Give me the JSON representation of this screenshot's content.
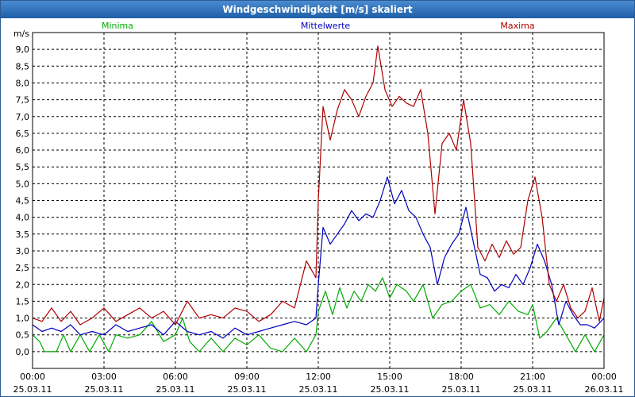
{
  "window": {
    "title": "Windgeschwindigkeit [m/s] skaliert"
  },
  "chart_data": {
    "type": "line",
    "title": "Windgeschwindigkeit [m/s] skaliert",
    "ylabel": "m/s",
    "xlabel": "",
    "ylim": [
      -0.5,
      9.5
    ],
    "xlim": [
      0,
      24
    ],
    "grid": true,
    "legend_placement": "top",
    "y_ticks": [
      "0,0",
      "0,5",
      "1,0",
      "1,5",
      "2,0",
      "2,5",
      "3,0",
      "3,5",
      "4,0",
      "4,5",
      "5,0",
      "5,5",
      "6,0",
      "6,5",
      "7,0",
      "7,5",
      "8,0",
      "8,5",
      "9,0"
    ],
    "x_ticks": [
      {
        "x": 0,
        "time": "00:00",
        "date": "25.03.11"
      },
      {
        "x": 3,
        "time": "03:00",
        "date": "25.03.11"
      },
      {
        "x": 6,
        "time": "06:00",
        "date": "25.03.11"
      },
      {
        "x": 9,
        "time": "09:00",
        "date": "25.03.11"
      },
      {
        "x": 12,
        "time": "12:00",
        "date": "25.03.11"
      },
      {
        "x": 15,
        "time": "15:00",
        "date": "25.03.11"
      },
      {
        "x": 18,
        "time": "18:00",
        "date": "25.03.11"
      },
      {
        "x": 21,
        "time": "21:00",
        "date": "25.03.11"
      },
      {
        "x": 24,
        "time": "00:00",
        "date": "26.03.11"
      }
    ],
    "series": [
      {
        "name": "Minima",
        "color": "#00aa00",
        "points": [
          [
            0,
            0.5
          ],
          [
            0.3,
            0.3
          ],
          [
            0.5,
            0.0
          ],
          [
            1,
            0.0
          ],
          [
            1.3,
            0.5
          ],
          [
            1.6,
            0.0
          ],
          [
            2,
            0.5
          ],
          [
            2.4,
            0.0
          ],
          [
            2.8,
            0.5
          ],
          [
            3.2,
            0.0
          ],
          [
            3.5,
            0.5
          ],
          [
            4,
            0.4
          ],
          [
            4.5,
            0.5
          ],
          [
            5,
            0.9
          ],
          [
            5.5,
            0.3
          ],
          [
            6,
            0.5
          ],
          [
            6.3,
            1.0
          ],
          [
            6.6,
            0.3
          ],
          [
            7,
            0.0
          ],
          [
            7.5,
            0.4
          ],
          [
            8,
            0.0
          ],
          [
            8.5,
            0.4
          ],
          [
            9,
            0.2
          ],
          [
            9.5,
            0.5
          ],
          [
            10,
            0.1
          ],
          [
            10.5,
            0.0
          ],
          [
            11,
            0.4
          ],
          [
            11.5,
            0.0
          ],
          [
            11.9,
            0.5
          ],
          [
            12,
            1.2
          ],
          [
            12.3,
            1.8
          ],
          [
            12.6,
            1.1
          ],
          [
            12.9,
            1.9
          ],
          [
            13.2,
            1.3
          ],
          [
            13.5,
            1.8
          ],
          [
            13.8,
            1.5
          ],
          [
            14.1,
            2.0
          ],
          [
            14.4,
            1.8
          ],
          [
            14.7,
            2.2
          ],
          [
            15,
            1.6
          ],
          [
            15.3,
            2.0
          ],
          [
            15.7,
            1.8
          ],
          [
            16,
            1.5
          ],
          [
            16.4,
            2.0
          ],
          [
            16.8,
            1.0
          ],
          [
            17.2,
            1.4
          ],
          [
            17.6,
            1.5
          ],
          [
            18,
            1.8
          ],
          [
            18.4,
            2.0
          ],
          [
            18.8,
            1.3
          ],
          [
            19.2,
            1.4
          ],
          [
            19.6,
            1.1
          ],
          [
            20,
            1.5
          ],
          [
            20.4,
            1.2
          ],
          [
            20.8,
            1.1
          ],
          [
            21,
            1.4
          ],
          [
            21.3,
            0.4
          ],
          [
            21.6,
            0.6
          ],
          [
            22,
            1.0
          ],
          [
            22.4,
            0.5
          ],
          [
            22.8,
            0.0
          ],
          [
            23.2,
            0.5
          ],
          [
            23.6,
            0.0
          ],
          [
            24,
            0.5
          ]
        ]
      },
      {
        "name": "Mittelwerte",
        "color": "#0000c0",
        "points": [
          [
            0,
            0.8
          ],
          [
            0.4,
            0.6
          ],
          [
            0.8,
            0.7
          ],
          [
            1.2,
            0.6
          ],
          [
            1.6,
            0.8
          ],
          [
            2,
            0.5
          ],
          [
            2.5,
            0.6
          ],
          [
            3,
            0.5
          ],
          [
            3.5,
            0.8
          ],
          [
            4,
            0.6
          ],
          [
            4.5,
            0.7
          ],
          [
            5,
            0.8
          ],
          [
            5.5,
            0.5
          ],
          [
            6,
            0.9
          ],
          [
            6.5,
            0.6
          ],
          [
            7,
            0.5
          ],
          [
            7.5,
            0.6
          ],
          [
            8,
            0.4
          ],
          [
            8.5,
            0.7
          ],
          [
            9,
            0.5
          ],
          [
            9.5,
            0.6
          ],
          [
            10,
            0.7
          ],
          [
            10.5,
            0.8
          ],
          [
            11,
            0.9
          ],
          [
            11.5,
            0.8
          ],
          [
            11.9,
            1.0
          ],
          [
            12,
            2.0
          ],
          [
            12.2,
            3.7
          ],
          [
            12.5,
            3.2
          ],
          [
            12.8,
            3.5
          ],
          [
            13.1,
            3.8
          ],
          [
            13.4,
            4.2
          ],
          [
            13.7,
            3.9
          ],
          [
            14,
            4.1
          ],
          [
            14.3,
            4.0
          ],
          [
            14.6,
            4.5
          ],
          [
            14.9,
            5.2
          ],
          [
            15.2,
            4.4
          ],
          [
            15.5,
            4.8
          ],
          [
            15.8,
            4.2
          ],
          [
            16.1,
            4.0
          ],
          [
            16.4,
            3.5
          ],
          [
            16.7,
            3.1
          ],
          [
            17,
            2.0
          ],
          [
            17.3,
            2.8
          ],
          [
            17.6,
            3.2
          ],
          [
            17.9,
            3.5
          ],
          [
            18.2,
            4.3
          ],
          [
            18.5,
            3.3
          ],
          [
            18.8,
            2.3
          ],
          [
            19.1,
            2.2
          ],
          [
            19.4,
            1.8
          ],
          [
            19.7,
            2.0
          ],
          [
            20,
            1.9
          ],
          [
            20.3,
            2.3
          ],
          [
            20.6,
            2.0
          ],
          [
            20.9,
            2.5
          ],
          [
            21.2,
            3.2
          ],
          [
            21.5,
            2.7
          ],
          [
            21.8,
            2.0
          ],
          [
            22.1,
            0.8
          ],
          [
            22.4,
            1.5
          ],
          [
            22.7,
            1.1
          ],
          [
            23,
            0.8
          ],
          [
            23.3,
            0.8
          ],
          [
            23.6,
            0.7
          ],
          [
            24,
            1.0
          ]
        ]
      },
      {
        "name": "Maxima",
        "color": "#b00000",
        "points": [
          [
            0,
            1.0
          ],
          [
            0.4,
            0.9
          ],
          [
            0.8,
            1.3
          ],
          [
            1.2,
            0.9
          ],
          [
            1.6,
            1.2
          ],
          [
            2,
            0.8
          ],
          [
            2.5,
            1.0
          ],
          [
            3,
            1.3
          ],
          [
            3.5,
            0.9
          ],
          [
            4,
            1.1
          ],
          [
            4.5,
            1.3
          ],
          [
            5,
            1.0
          ],
          [
            5.5,
            1.2
          ],
          [
            6,
            0.8
          ],
          [
            6.5,
            1.5
          ],
          [
            7,
            1.0
          ],
          [
            7.5,
            1.1
          ],
          [
            8,
            1.0
          ],
          [
            8.5,
            1.3
          ],
          [
            9,
            1.2
          ],
          [
            9.5,
            0.9
          ],
          [
            10,
            1.1
          ],
          [
            10.5,
            1.5
          ],
          [
            11,
            1.3
          ],
          [
            11.5,
            2.7
          ],
          [
            11.9,
            2.2
          ],
          [
            12,
            4.5
          ],
          [
            12.2,
            7.3
          ],
          [
            12.5,
            6.3
          ],
          [
            12.8,
            7.2
          ],
          [
            13.1,
            7.8
          ],
          [
            13.4,
            7.5
          ],
          [
            13.7,
            7.0
          ],
          [
            14,
            7.6
          ],
          [
            14.3,
            8.0
          ],
          [
            14.5,
            9.1
          ],
          [
            14.8,
            7.8
          ],
          [
            15.1,
            7.3
          ],
          [
            15.4,
            7.6
          ],
          [
            15.7,
            7.4
          ],
          [
            16,
            7.3
          ],
          [
            16.3,
            7.8
          ],
          [
            16.6,
            6.5
          ],
          [
            16.9,
            4.1
          ],
          [
            17.2,
            6.2
          ],
          [
            17.5,
            6.5
          ],
          [
            17.8,
            6.0
          ],
          [
            18.1,
            7.5
          ],
          [
            18.4,
            6.2
          ],
          [
            18.7,
            3.1
          ],
          [
            19,
            2.7
          ],
          [
            19.3,
            3.2
          ],
          [
            19.6,
            2.8
          ],
          [
            19.9,
            3.3
          ],
          [
            20.2,
            2.9
          ],
          [
            20.5,
            3.1
          ],
          [
            20.8,
            4.5
          ],
          [
            21.1,
            5.2
          ],
          [
            21.4,
            4.0
          ],
          [
            21.7,
            2.0
          ],
          [
            22,
            1.5
          ],
          [
            22.3,
            2.0
          ],
          [
            22.6,
            1.3
          ],
          [
            22.9,
            1.0
          ],
          [
            23.2,
            1.2
          ],
          [
            23.5,
            1.9
          ],
          [
            23.8,
            0.9
          ],
          [
            24,
            1.6
          ]
        ]
      }
    ]
  }
}
